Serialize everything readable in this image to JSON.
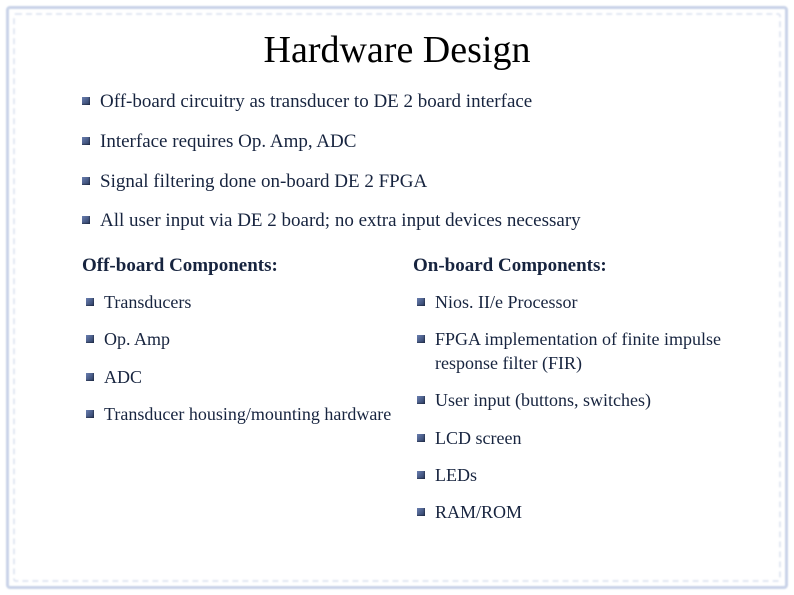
{
  "title": "Hardware Design",
  "topBullets": [
    "Off-board circuitry as transducer to DE 2 board interface",
    "Interface requires Op. Amp, ADC",
    "Signal filtering done on-board DE 2 FPGA",
    "All user input via DE 2 board; no extra input devices necessary"
  ],
  "leftColumn": {
    "heading": "Off-board Components:",
    "items": [
      "Transducers",
      "Op. Amp",
      "ADC",
      "Transducer housing/mounting hardware"
    ]
  },
  "rightColumn": {
    "heading": "On-board Components:",
    "items": [
      "Nios. II/e Processor",
      "FPGA implementation of finite impulse response filter (FIR)",
      "User input (buttons, switches)",
      "LCD screen",
      "LEDs",
      "RAM/ROM"
    ]
  }
}
